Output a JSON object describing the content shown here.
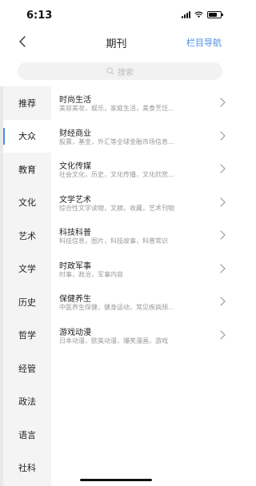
{
  "status": {
    "time": "6:13"
  },
  "nav": {
    "title": "期刊",
    "right_label": "栏目导航"
  },
  "search": {
    "placeholder": "搜索"
  },
  "categories": [
    {
      "label": "推荐"
    },
    {
      "label": "大众"
    },
    {
      "label": "教育"
    },
    {
      "label": "文化"
    },
    {
      "label": "艺术"
    },
    {
      "label": "文学"
    },
    {
      "label": "历史"
    },
    {
      "label": "哲学"
    },
    {
      "label": "经管"
    },
    {
      "label": "政法"
    },
    {
      "label": "语言"
    },
    {
      "label": "社科"
    }
  ],
  "active_category": "大众",
  "items": [
    {
      "title": "时尚生活",
      "subtitle": "美容美妆，娱乐，家庭生活，美食烹饪..."
    },
    {
      "title": "财经商业",
      "subtitle": "股票，基金，外汇等全球金融市场信息..."
    },
    {
      "title": "文化传媒",
      "subtitle": "社会文化，历史，文化传播，文化欣赏..."
    },
    {
      "title": "文学艺术",
      "subtitle": "综合性文学读物，文摘，收藏，艺术刊物"
    },
    {
      "title": "科技科普",
      "subtitle": "科技信息，图片，科技故事，科普常识"
    },
    {
      "title": "时政军事",
      "subtitle": "时事，政治，军事内容"
    },
    {
      "title": "保健养生",
      "subtitle": "中医养生保健，健身运动，常见疾病预..."
    },
    {
      "title": "游戏动漫",
      "subtitle": "日本动漫，欧美动漫，爆笑漫画，游戏"
    }
  ],
  "colors": {
    "accent": "#4a90e2",
    "sidebar_bg": "#f4f4f4",
    "search_bg": "#f2f2f2"
  }
}
